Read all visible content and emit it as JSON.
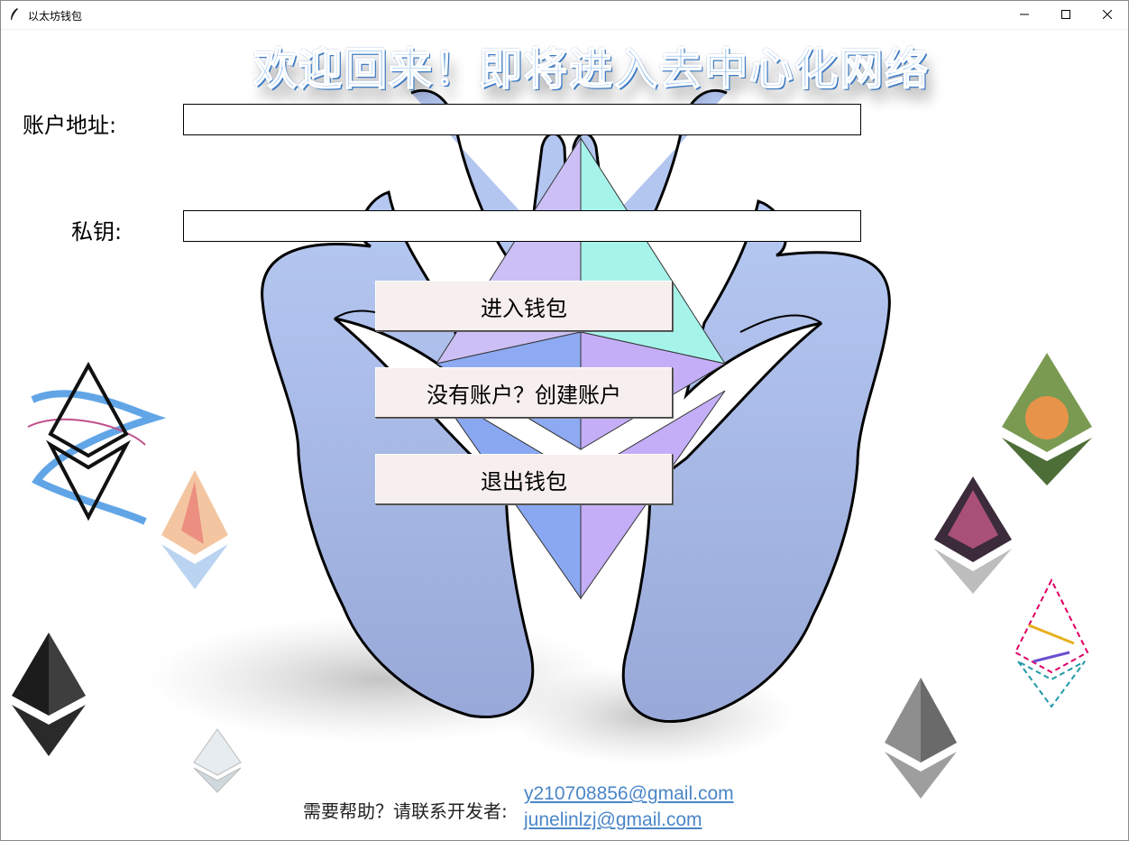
{
  "window": {
    "title": "以太坊钱包",
    "controls": [
      "minimize-icon",
      "maximize-icon",
      "close-icon"
    ]
  },
  "banner": {
    "text": "欢迎回来！即将进入去中心化网络"
  },
  "form": {
    "address_label": "账户地址:",
    "address_value": "",
    "private_key_label": "私钥:",
    "private_key_value": ""
  },
  "buttons": {
    "enter": "进入钱包",
    "create": "没有账户？创建账户",
    "exit": "退出钱包"
  },
  "footer": {
    "help_text": "需要帮助？请联系开发者:",
    "emails": [
      "y210708856@gmail.com",
      "junelinlzj@gmail.com"
    ]
  },
  "colors": {
    "banner": "#7fb3e8",
    "button_bg": "#f7eeee",
    "link": "#4a86c8",
    "hands": "#a9bde8"
  }
}
